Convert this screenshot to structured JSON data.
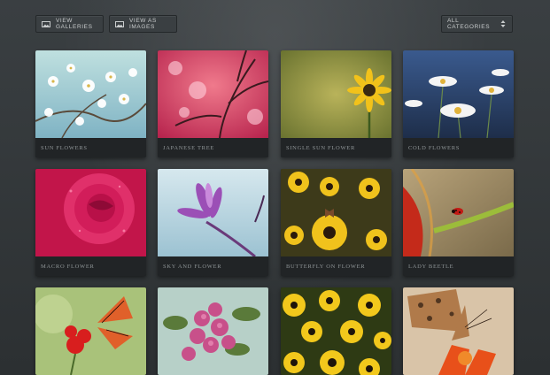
{
  "toolbar": {
    "view_galleries": "View Galleries",
    "view_images": "View as Images",
    "category_selected": "All Categories"
  },
  "gallery": [
    {
      "title": "Sun Flowers"
    },
    {
      "title": "Japanese Tree"
    },
    {
      "title": "Single Sun Flower"
    },
    {
      "title": "Cold Flowers"
    },
    {
      "title": "Macro Flower"
    },
    {
      "title": "Sky and Flower"
    },
    {
      "title": "Butterfly on Flower"
    },
    {
      "title": "Lady Beetle"
    },
    {
      "title": ""
    },
    {
      "title": ""
    },
    {
      "title": ""
    },
    {
      "title": ""
    }
  ],
  "colors": {
    "background": "#2f3335",
    "card": "#1c1f21",
    "caption_text": "#8f9597"
  }
}
